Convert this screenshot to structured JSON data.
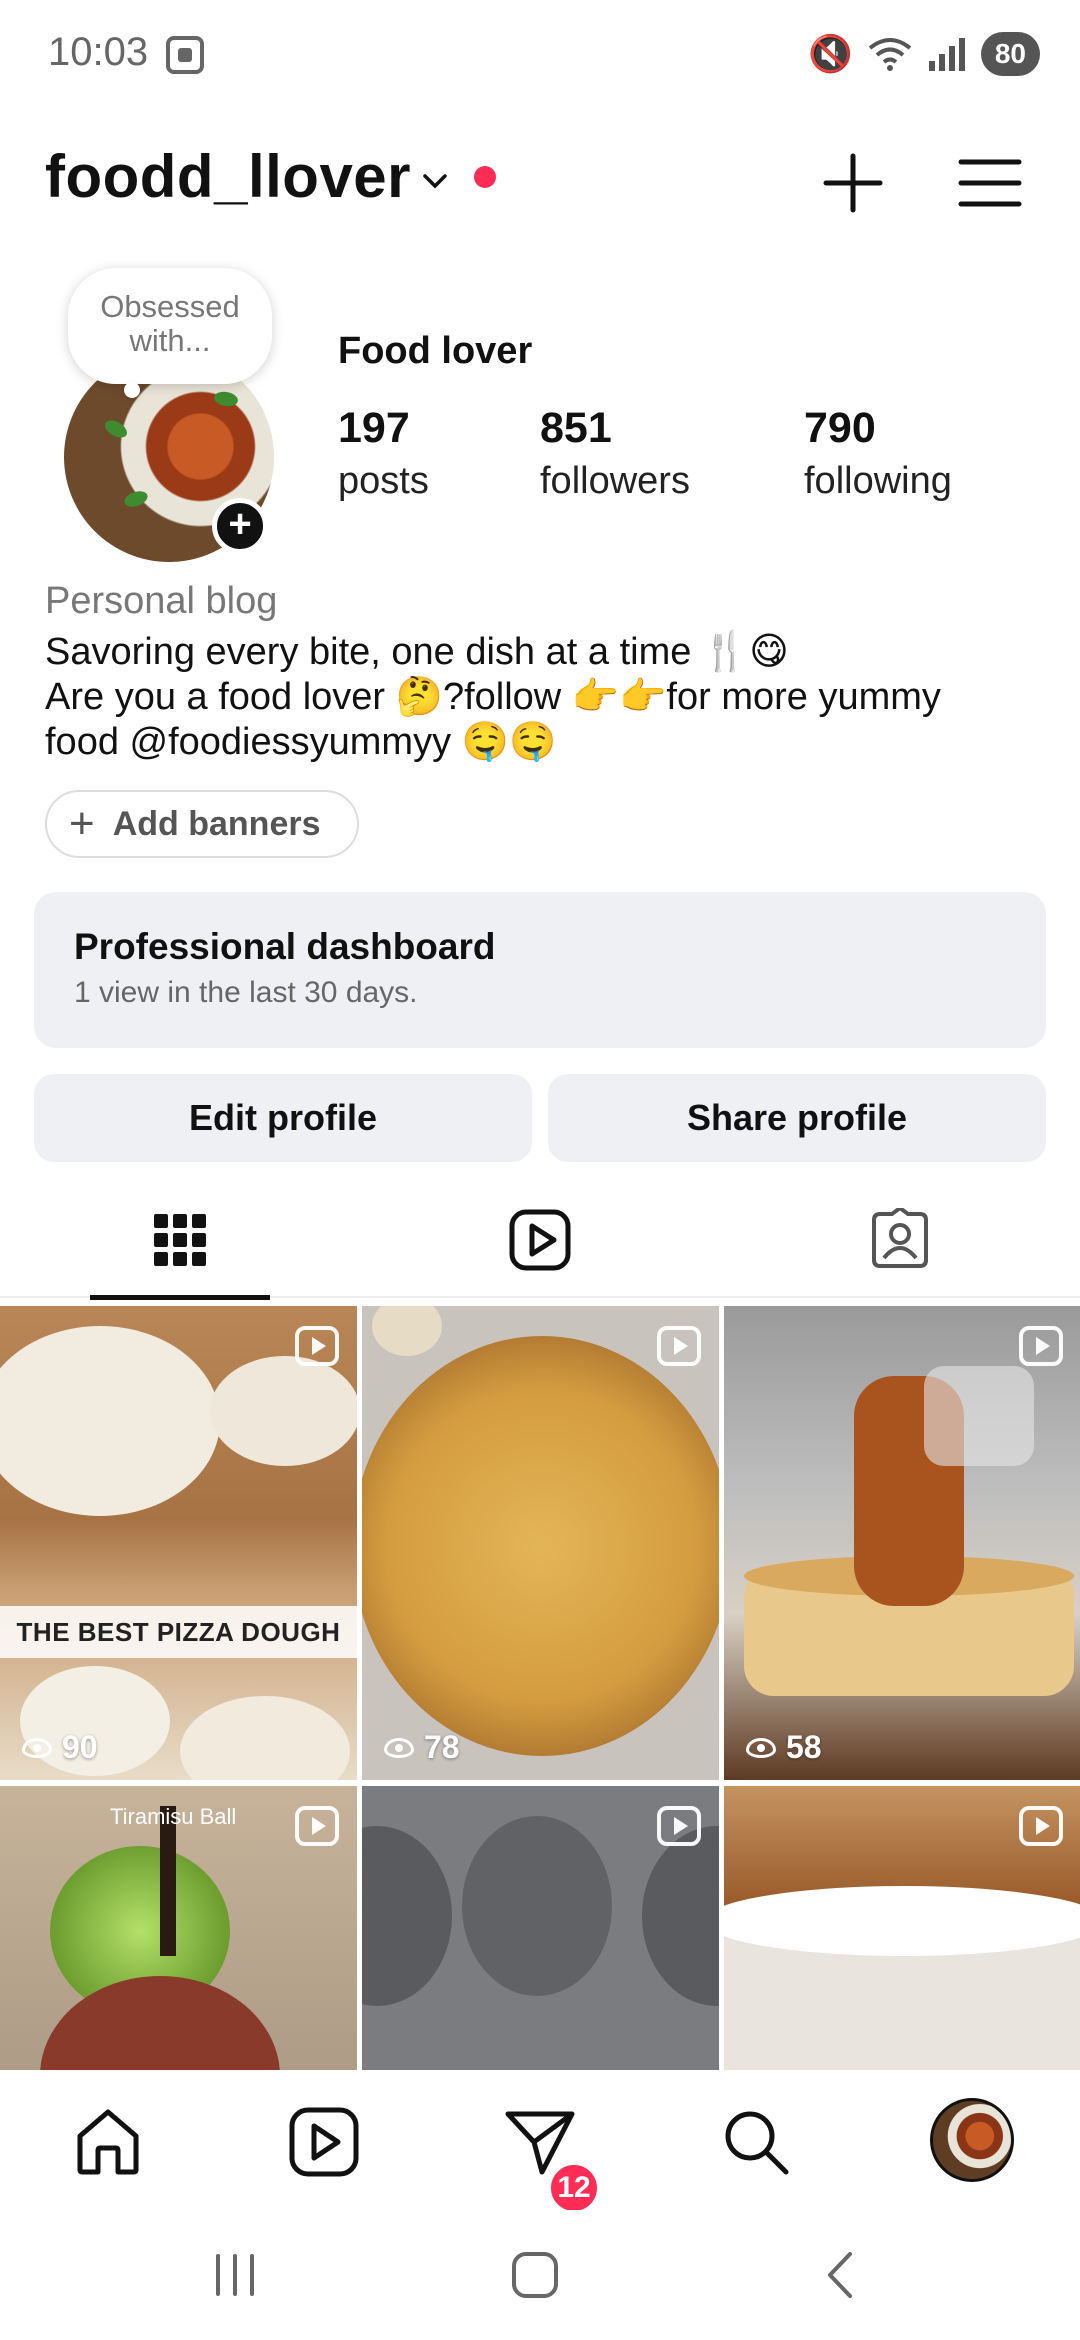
{
  "status_bar": {
    "time": "10:03",
    "battery": "80"
  },
  "header": {
    "username": "foodd_llover"
  },
  "profile": {
    "note": "Obsessed with...",
    "display_name": "Food lover",
    "stats": [
      {
        "value": "197",
        "label": "posts"
      },
      {
        "value": "851",
        "label": "followers"
      },
      {
        "value": "790",
        "label": "following"
      }
    ],
    "category": "Personal blog",
    "bio_lines": [
      "Savoring every bite, one dish at a time 🍴😋",
      "Are you a food lover 🤔?follow 👉👉for more yummy",
      "food @foodiessyummyy 🤤🤤"
    ],
    "add_banners": "Add banners"
  },
  "dashboard": {
    "title": "Professional dashboard",
    "subtitle": "1 view in the last 30 days."
  },
  "buttons": {
    "edit": "Edit profile",
    "share": "Share profile"
  },
  "tabs": [
    "grid-icon",
    "reels-icon",
    "tagged-icon"
  ],
  "posts": [
    {
      "views": "90",
      "caption": "THE BEST PIZZA DOUGH",
      "kind": "reel"
    },
    {
      "views": "78",
      "kind": "reel"
    },
    {
      "views": "58",
      "kind": "reel"
    },
    {
      "overlay_text": "Tiramisu Ball",
      "kind": "reel"
    },
    {
      "kind": "reel"
    },
    {
      "kind": "reel"
    }
  ],
  "bottom_nav": {
    "messages_badge": "12"
  },
  "colors": {
    "accent_red": "#ff2d55",
    "button_bg": "#eff0f4",
    "text": "#111111",
    "muted": "#777777"
  }
}
